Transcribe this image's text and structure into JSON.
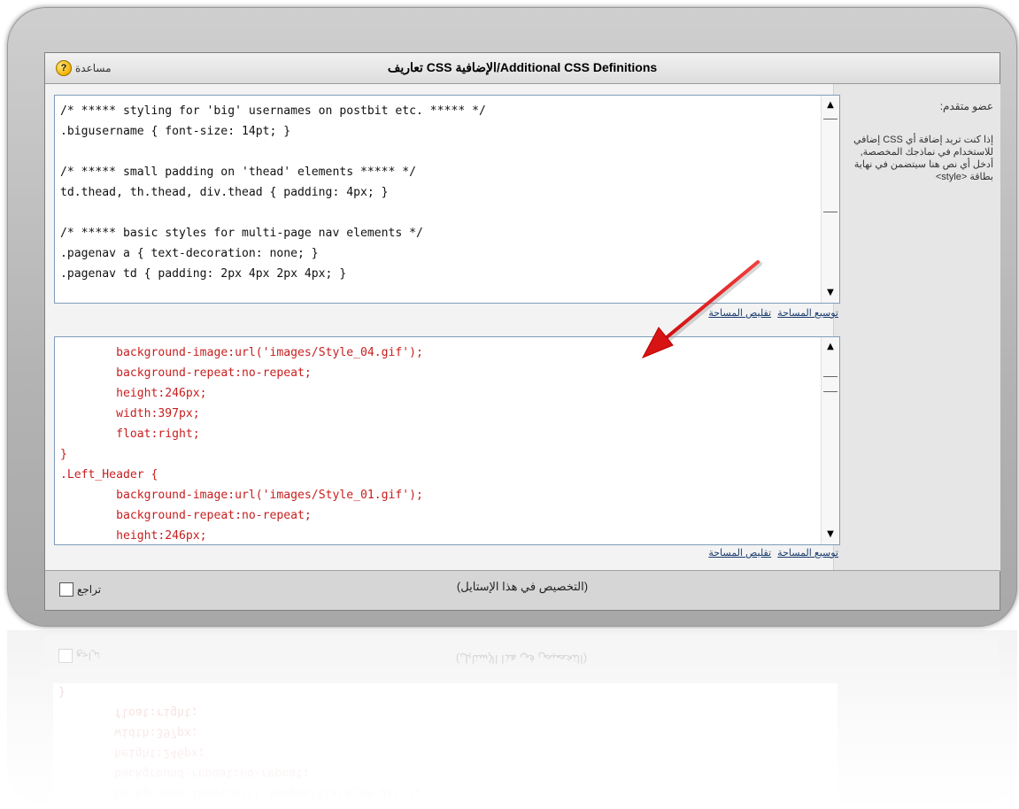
{
  "panel": {
    "title": "تعاريف CSS الإضافية/Additional CSS Definitions",
    "help_label": "مساعدة",
    "help_icon_glyph": "?"
  },
  "side": {
    "member_label": "عضو متقدم:",
    "description": "إذا كنت تريد إضافة أي CSS إضافي للاستخدام في نماذجك المخصصة, أدخل أي نص هنا سيتضمن في نهاية بطاقة <style>"
  },
  "editor1": {
    "content": "/* ***** styling for 'big' usernames on postbit etc. ***** */\n.bigusername { font-size: 14pt; }\n\n/* ***** small padding on 'thead' elements ***** */\ntd.thead, th.thead, div.thead { padding: 4px; }\n\n/* ***** basic styles for multi-page nav elements */\n.pagenav a { text-decoration: none; }\n.pagenav td { padding: 2px 4px 2px 4px; }"
  },
  "editor2": {
    "content": "\tbackground-image:url('images/Style_04.gif');\n\tbackground-repeat:no-repeat;\n\theight:246px;\n\twidth:397px;\n\tfloat:right;\n}\n.Left_Header {\n\tbackground-image:url('images/Style_01.gif');\n\tbackground-repeat:no-repeat;\n\theight:246px;"
  },
  "resize": {
    "expand": "توسيع المساحة",
    "shrink": "تقليص المساحة"
  },
  "footer": {
    "customization_text": "(التخصيص في هذا الإستايل)",
    "revert_label": "تراجع"
  },
  "colors": {
    "code_dark": "#111111",
    "code_red": "#c81e1e",
    "arrow_red": "#e01818"
  }
}
